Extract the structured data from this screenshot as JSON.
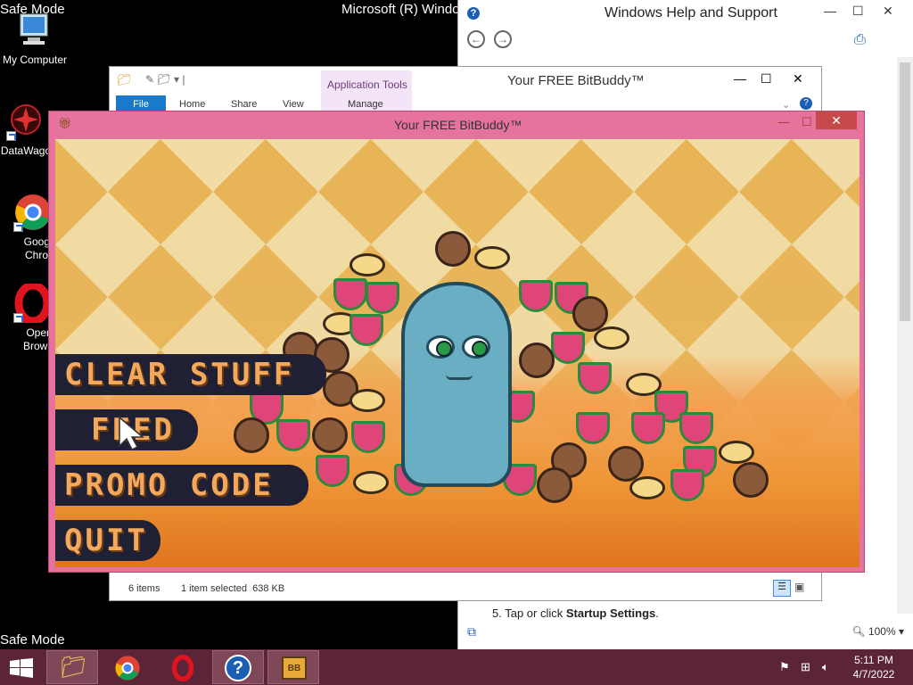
{
  "desktop": {
    "safe_mode_top": "Safe Mode",
    "safe_mode_bottom": "Safe Mode",
    "window_title_partial": "Microsoft (R) Windo",
    "icons": [
      {
        "label": "My Computer"
      },
      {
        "label": "DataWago"
      },
      {
        "label": "Google Chrom"
      },
      {
        "label": "Opera Browse"
      }
    ]
  },
  "help_window": {
    "title": "Windows Help and Support",
    "step_number": "5.",
    "step_text_prefix": "Tap or click ",
    "step_text_bold": "Startup Settings",
    "step_text_suffix": ".",
    "zoom": "100%"
  },
  "explorer_window": {
    "title": "Your FREE BitBuddy™",
    "app_tools": "Application Tools",
    "tabs": [
      "File",
      "Home",
      "Share",
      "View",
      "Manage"
    ],
    "status_items": "6 items",
    "status_selected": "1 item selected  638 KB"
  },
  "game_window": {
    "title": "Your FREE BitBuddy™",
    "menu": [
      "CLEAR STUFF",
      "FEED",
      "PROMO CODE",
      "QUIT"
    ]
  },
  "taskbar": {
    "time": "5:11 PM",
    "date": "4/7/2022"
  },
  "colors": {
    "taskbar": "#5c2537",
    "game_border": "#e6739d",
    "menu_bg": "#1f2034",
    "menu_text": "#f3a85c"
  }
}
